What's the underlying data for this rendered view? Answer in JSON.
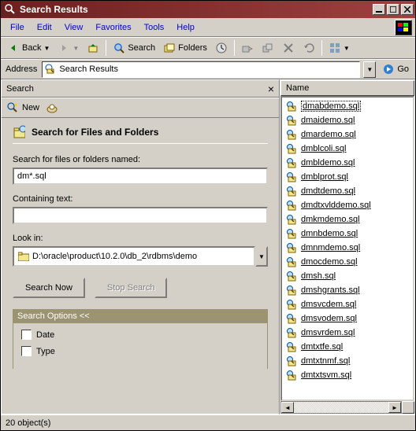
{
  "window": {
    "title": "Search Results",
    "min": "_",
    "max": "□",
    "close": "✕"
  },
  "menu": [
    "File",
    "Edit",
    "View",
    "Favorites",
    "Tools",
    "Help"
  ],
  "toolbar": {
    "back": "Back",
    "search": "Search",
    "folders": "Folders"
  },
  "address": {
    "label": "Address",
    "value": "Search Results",
    "go": "Go"
  },
  "searchPane": {
    "header": "Search",
    "new": "New",
    "title": "Search for Files and Folders",
    "namedLabel": "Search for files or folders named:",
    "namedValue": "dm*.sql",
    "containingLabel": "Containing text:",
    "containingValue": "",
    "lookInLabel": "Look in:",
    "lookInValue": "D:\\oracle\\product\\10.2.0\\db_2\\rdbms\\demo",
    "searchNow": "Search Now",
    "stopSearch": "Stop Search",
    "optionsHeader": "Search Options  <<",
    "dateLabel": "Date",
    "typeLabel": "Type"
  },
  "results": {
    "columnHeader": "Name",
    "files": [
      "dmabdemo.sql",
      "dmaidemo.sql",
      "dmardemo.sql",
      "dmblcoli.sql",
      "dmbldemo.sql",
      "dmblprot.sql",
      "dmdtdemo.sql",
      "dmdtxvlddemo.sql",
      "dmkmdemo.sql",
      "dmnbdemo.sql",
      "dmnmdemo.sql",
      "dmocdemo.sql",
      "dmsh.sql",
      "dmshgrants.sql",
      "dmsvcdem.sql",
      "dmsvodem.sql",
      "dmsvrdem.sql",
      "dmtxtfe.sql",
      "dmtxtnmf.sql",
      "dmtxtsvm.sql"
    ]
  },
  "status": "20 object(s)"
}
